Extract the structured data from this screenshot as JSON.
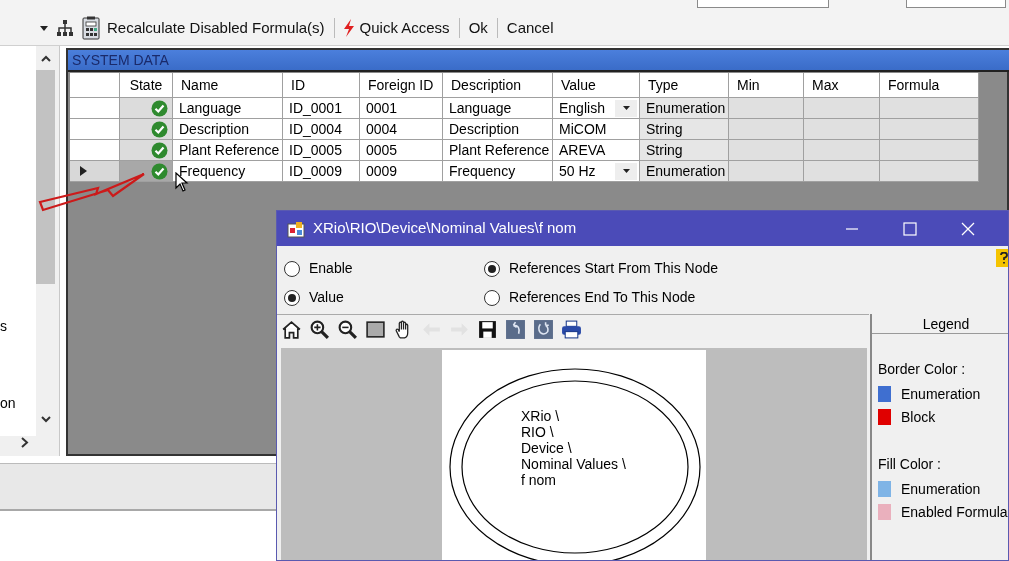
{
  "toolbar": {
    "items": [
      {
        "kind": "dropdown"
      },
      {
        "kind": "icon-button"
      },
      {
        "kind": "button",
        "label": "Recalculate Disabled Formula(s)"
      },
      {
        "kind": "button",
        "label": "Quick Access"
      },
      {
        "kind": "button",
        "label": "Ok"
      },
      {
        "kind": "button",
        "label": "Cancel"
      }
    ]
  },
  "left_tree": {
    "items": [
      "s",
      "on"
    ]
  },
  "system_data": {
    "title": "SYSTEM DATA",
    "columns": [
      "State",
      "Name",
      "ID",
      "Foreign ID",
      "Description",
      "Value",
      "Type",
      "Min",
      "Max",
      "Formula"
    ],
    "rows": [
      {
        "selected": false,
        "valid": true,
        "name": "Language",
        "id": "ID_0001",
        "foreign_id": "0001",
        "description": "Language",
        "value": "English",
        "dropdown": true,
        "type": "Enumeration"
      },
      {
        "selected": false,
        "valid": true,
        "name": "Description",
        "id": "ID_0004",
        "foreign_id": "0004",
        "description": "Description",
        "value": "MiCOM",
        "dropdown": false,
        "type": "String"
      },
      {
        "selected": false,
        "valid": true,
        "name": "Plant Reference",
        "id": "ID_0005",
        "foreign_id": "0005",
        "description": "Plant Reference",
        "value": "AREVA",
        "dropdown": false,
        "type": "String"
      },
      {
        "selected": true,
        "valid": true,
        "name": "Frequency",
        "id": "ID_0009",
        "foreign_id": "0009",
        "description": "Frequency",
        "value": "50 Hz",
        "dropdown": true,
        "type": "Enumeration"
      }
    ]
  },
  "dialog": {
    "title": "XRio\\RIO\\Device\\Nominal Values\\f nom",
    "options": [
      {
        "label": "Enable",
        "selected": false
      },
      {
        "label": "Value",
        "selected": true
      }
    ],
    "references": [
      {
        "label": "References Start From This Node",
        "selected": true
      },
      {
        "label": "References End To This Node",
        "selected": false
      }
    ],
    "graph_tools": [
      {
        "disabled": false
      },
      {
        "disabled": false
      },
      {
        "disabled": false
      },
      {
        "disabled": false
      },
      {
        "disabled": false
      },
      {
        "disabled": true
      },
      {
        "disabled": true
      },
      {
        "disabled": false
      },
      {
        "disabled": false
      },
      {
        "disabled": false
      },
      {
        "disabled": false
      }
    ],
    "node": {
      "lines": [
        "XRio \\",
        "RIO \\",
        "Device \\",
        "Nominal Values \\",
        "f nom"
      ]
    },
    "legend": {
      "title": "Legend",
      "sections": [
        {
          "heading": "Border Color :",
          "items": [
            {
              "label": "Enumeration",
              "color": "#3f6fd0"
            },
            {
              "label": "Block",
              "color": "#e00000"
            }
          ]
        },
        {
          "heading": "Fill Color :",
          "items": [
            {
              "label": "Enumeration",
              "color": "#7fb4e6"
            },
            {
              "label": "Enabled Formula",
              "color": "#eab0bd"
            }
          ]
        }
      ]
    }
  }
}
